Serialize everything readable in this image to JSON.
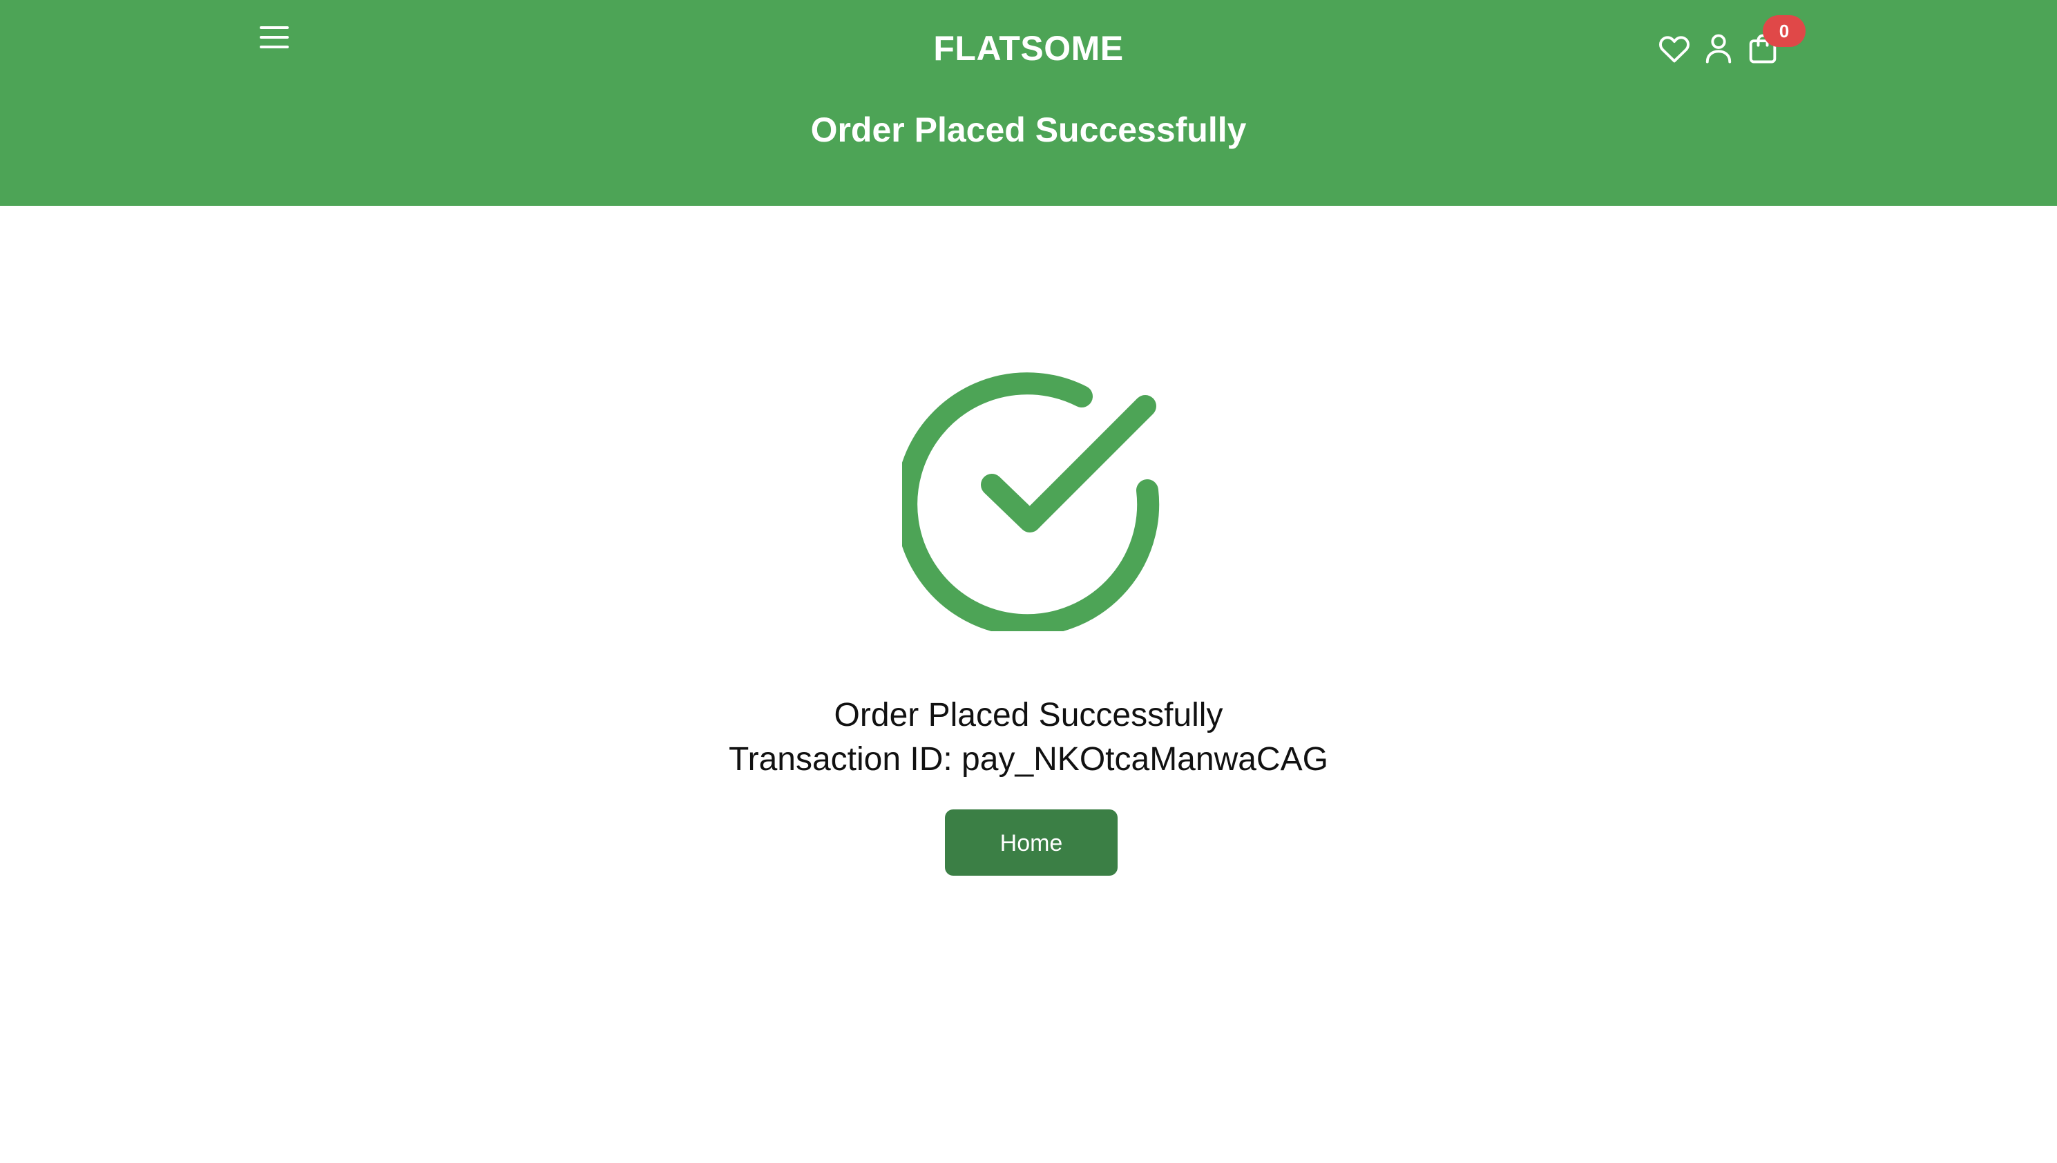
{
  "header": {
    "brand": "FLATSOME",
    "title": "Order Placed Successfully",
    "background_color": "#4da456",
    "icons": [
      "menu-icon",
      "heart-icon",
      "user-icon",
      "cart-icon"
    ],
    "cart_count": "0",
    "badge_color": "#e04848"
  },
  "main": {
    "status_icon": "check-circle-icon",
    "icon_color": "#4da456",
    "message": "Order Placed Successfully",
    "transaction": "Transaction ID: pay_NKOtcaManwaCAG",
    "home_label": "Home",
    "button_color": "#3b7f45"
  }
}
